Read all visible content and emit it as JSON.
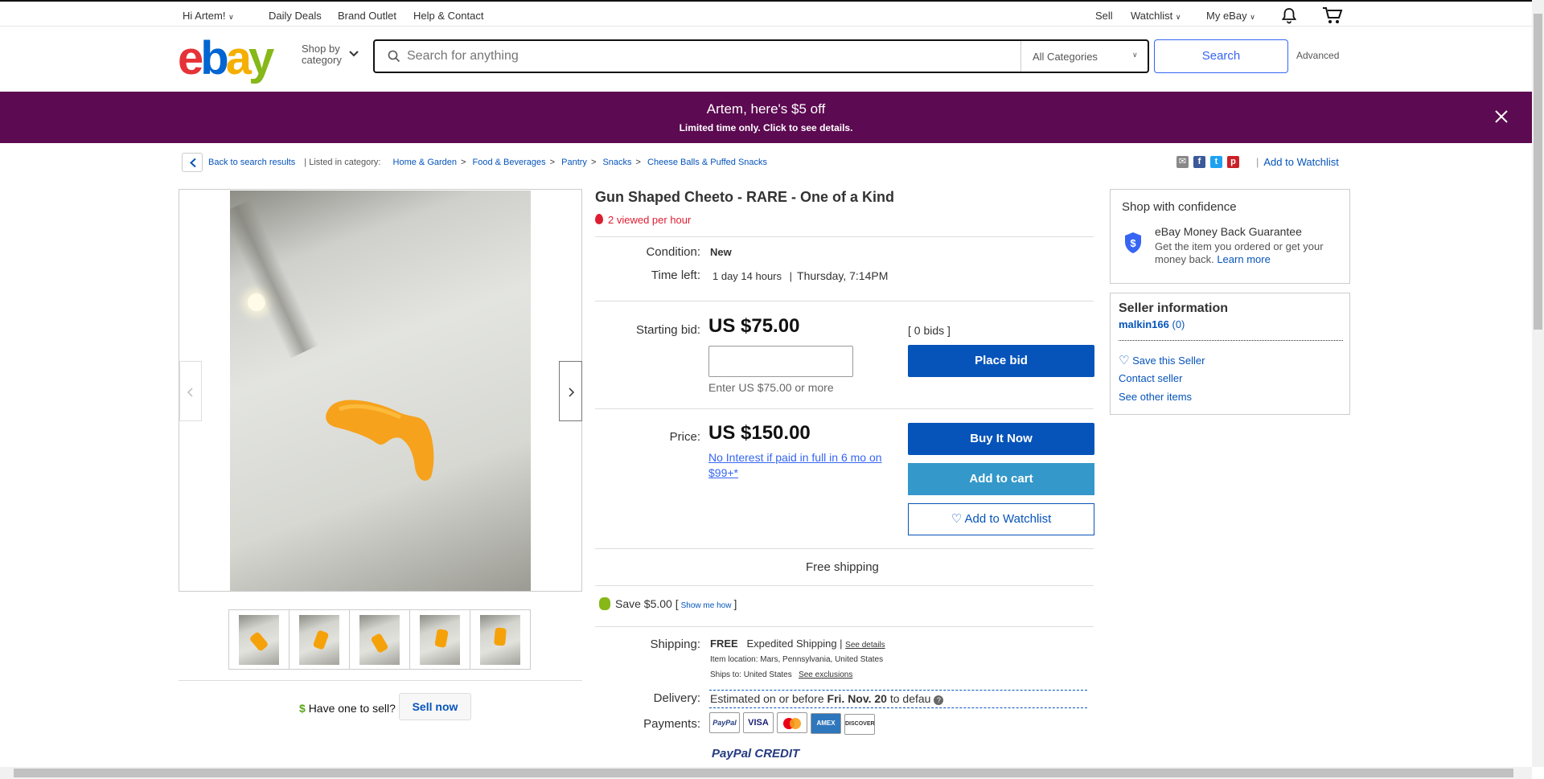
{
  "topbar": {
    "greeting": "Hi Artem!",
    "daily_deals": "Daily Deals",
    "brand_outlet": "Brand Outlet",
    "help": "Help & Contact",
    "sell": "Sell",
    "watchlist": "Watchlist",
    "my_ebay": "My eBay"
  },
  "header": {
    "logo": "ebay",
    "shop_by_1": "Shop by",
    "shop_by_2": "category",
    "search_placeholder": "Search for anything",
    "category_select": "All Categories",
    "search_button": "Search",
    "advanced": "Advanced"
  },
  "banner": {
    "title": "Artem, here's $5 off",
    "subtitle": "Limited time only.  Click to see details."
  },
  "breadcrumb": {
    "back": "Back to search results",
    "listed_in": "| Listed in category:",
    "items": [
      "Home & Garden",
      "Food & Beverages",
      "Pantry",
      "Snacks",
      "Cheese Balls & Puffed Snacks"
    ],
    "add_to_watchlist": "Add to Watchlist"
  },
  "listing": {
    "title": "Gun Shaped Cheeto - RARE - One of a Kind",
    "viewed": "2 viewed per hour",
    "condition_label": "Condition:",
    "condition_value": "New",
    "time_left_label": "Time left:",
    "time_left_value": "1 day 14 hours",
    "time_left_sep": "|",
    "time_left_end": "Thursday, 7:14PM",
    "starting_bid_label": "Starting bid:",
    "starting_bid_value": "US $75.00",
    "bids": "[ 0 bids ]",
    "bid_hint": "Enter US $75.00 or more",
    "place_bid": "Place bid",
    "price_label": "Price:",
    "price_value": "US $150.00",
    "no_interest": "No Interest if paid in full in 6 mo on $99+",
    "no_interest_asterisk": "*",
    "buy_it_now": "Buy It Now",
    "add_to_cart": "Add to cart",
    "add_to_watchlist": "Add to Watchlist",
    "free_shipping": "Free shipping",
    "save_amount": "Save $5.00 [",
    "show_me_how": "Show me how",
    "save_close": "]",
    "shipping_label": "Shipping:",
    "shipping_value": "FREE",
    "shipping_method": "Expedited Shipping |",
    "see_details": "See details",
    "item_location": "Item location:  Mars, Pennsylvania, United States",
    "ships_to": "Ships to:  United States",
    "see_exclusions": "See exclusions",
    "delivery_label": "Delivery:",
    "delivery_value": "Estimated on or before",
    "delivery_date": "Fri. Nov. 20",
    "delivery_tail": "to defau",
    "payments_label": "Payments:",
    "payment_methods": [
      "PayPal",
      "VISA",
      "MC",
      "AMEX",
      "DISCOVER"
    ],
    "paypal_credit": "PayPal CREDIT"
  },
  "gallery": {
    "have_one": "Have one to sell?",
    "sell_now": "Sell now"
  },
  "sidebar": {
    "confidence_title": "Shop with confidence",
    "guarantee_title": "eBay Money Back Guarantee",
    "guarantee_text": "Get the item you ordered or get your money back.",
    "learn_more": "Learn more",
    "seller_title": "Seller information",
    "seller_name": "malkin166",
    "seller_score": "(0)",
    "save_seller": "Save this Seller",
    "contact_seller": "Contact seller",
    "see_other": "See other items"
  },
  "colors": {
    "banner": "#5c0a51",
    "primary_button": "#0654ba",
    "cart_button": "#3498ca",
    "alert_red": "#dd1e31"
  }
}
